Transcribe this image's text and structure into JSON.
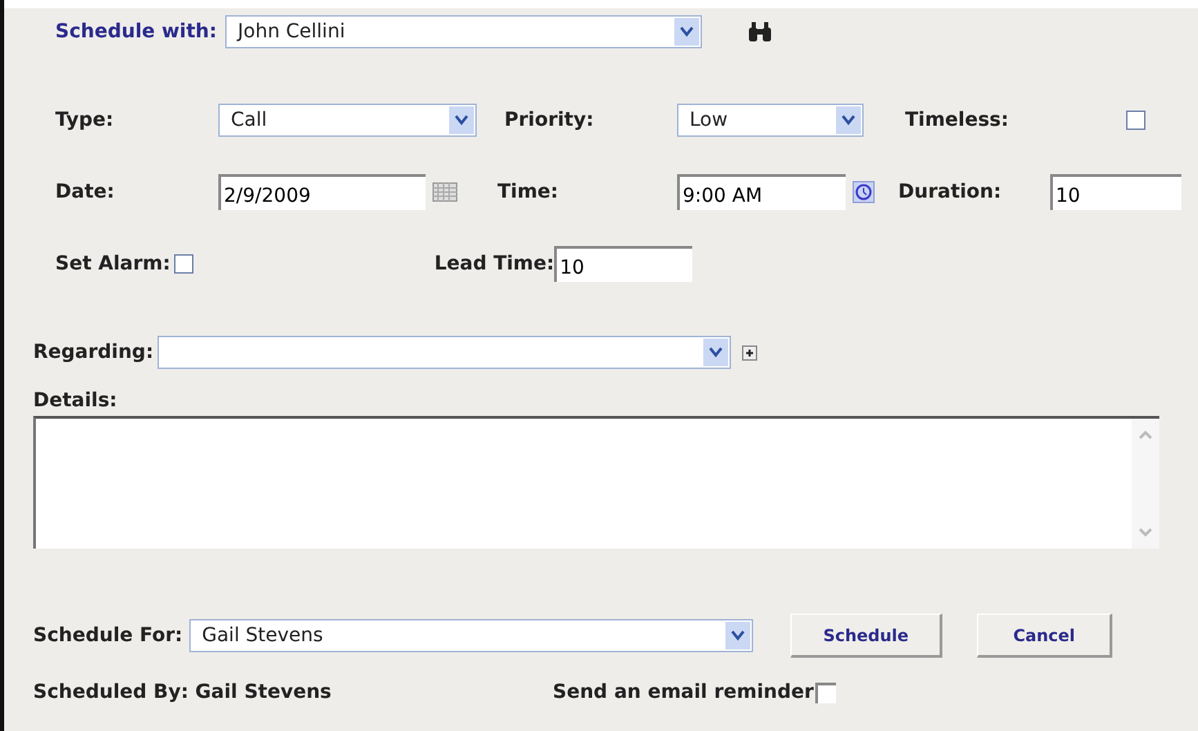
{
  "schedule_with": {
    "label": "Schedule with:",
    "value": "John Cellini"
  },
  "type": {
    "label": "Type:",
    "value": "Call"
  },
  "priority": {
    "label": "Priority:",
    "value": "Low"
  },
  "timeless": {
    "label": "Timeless:",
    "checked": false
  },
  "date": {
    "label": "Date:",
    "value": "2/9/2009"
  },
  "time": {
    "label": "Time:",
    "value": "9:00 AM"
  },
  "duration": {
    "label": "Duration:",
    "value": "10"
  },
  "set_alarm": {
    "label": "Set Alarm:",
    "checked": false
  },
  "lead_time": {
    "label": "Lead Time:",
    "value": "10"
  },
  "regarding": {
    "label": "Regarding:"
  },
  "details": {
    "label": "Details:"
  },
  "schedule_for": {
    "label": "Schedule For:",
    "value": "Gail Stevens"
  },
  "buttons": [
    "Schedule",
    "Cancel"
  ],
  "scheduled_by": "Scheduled By: Gail Stevens",
  "email_reminder": {
    "label": "Send an email reminder",
    "checked": false
  }
}
